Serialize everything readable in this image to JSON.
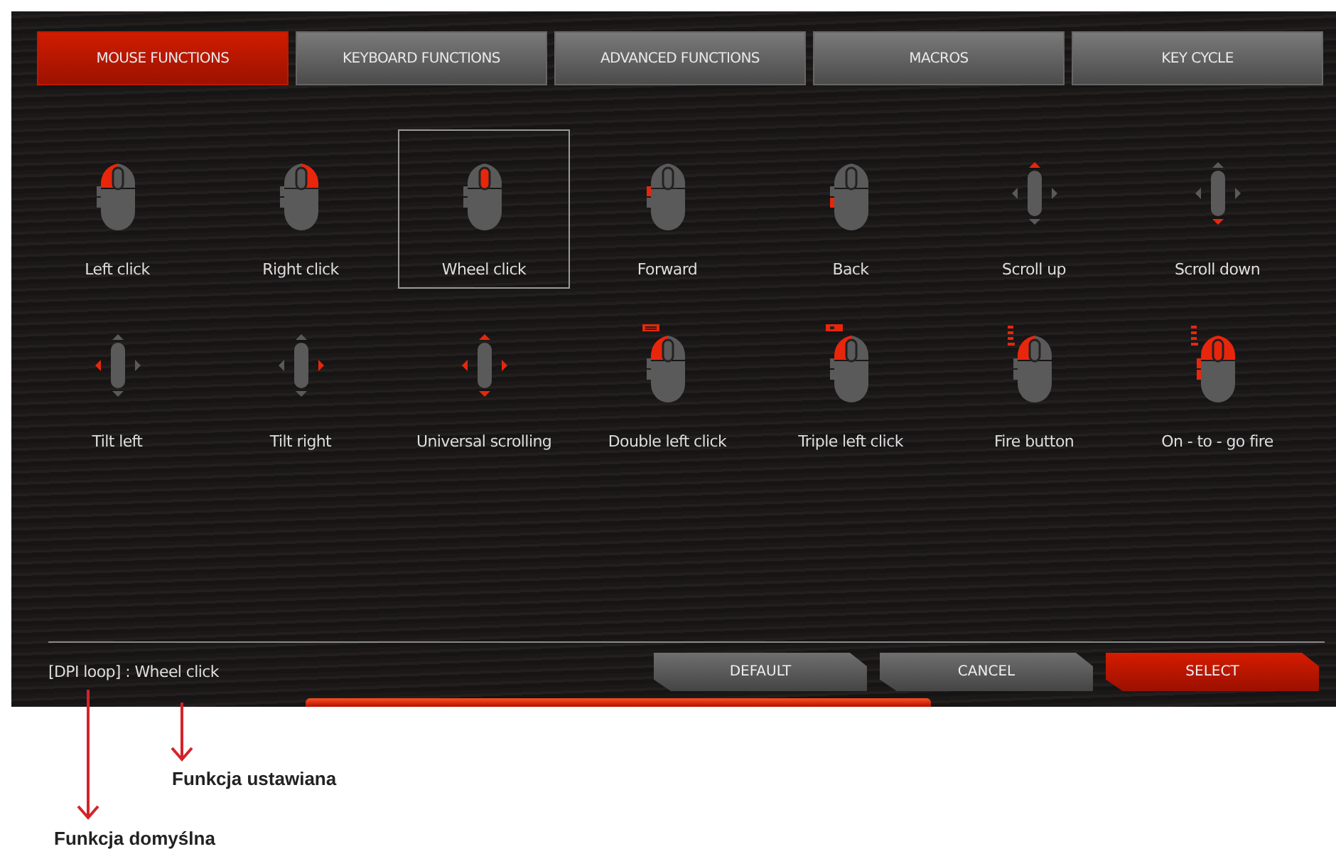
{
  "tabs": [
    {
      "label": "MOUSE FUNCTIONS",
      "selected": true
    },
    {
      "label": "KEYBOARD FUNCTIONS",
      "selected": false
    },
    {
      "label": "ADVANCED FUNCTIONS",
      "selected": false
    },
    {
      "label": "MACROS",
      "selected": false
    },
    {
      "label": "KEY CYCLE",
      "selected": false
    }
  ],
  "functions": [
    {
      "label": "Left click",
      "kind": "left",
      "selected": false
    },
    {
      "label": "Right click",
      "kind": "right",
      "selected": false
    },
    {
      "label": "Wheel click",
      "kind": "wheel",
      "selected": true
    },
    {
      "label": "Forward",
      "kind": "forward",
      "selected": false
    },
    {
      "label": "Back",
      "kind": "back",
      "selected": false
    },
    {
      "label": "Scroll up",
      "kind": "scroll-up",
      "selected": false
    },
    {
      "label": "Scroll down",
      "kind": "scroll-down",
      "selected": false
    },
    {
      "label": "Tilt left",
      "kind": "tilt-left",
      "selected": false
    },
    {
      "label": "Tilt right",
      "kind": "tilt-right",
      "selected": false
    },
    {
      "label": "Universal scrolling",
      "kind": "scroll-all",
      "selected": false
    },
    {
      "label": "Double left click",
      "kind": "double",
      "selected": false
    },
    {
      "label": "Triple left click",
      "kind": "triple",
      "selected": false
    },
    {
      "label": "Fire button",
      "kind": "fire",
      "selected": false
    },
    {
      "label": "On - to - go fire",
      "kind": "onetogo",
      "selected": false
    }
  ],
  "status": "[DPI loop] : Wheel click",
  "buttons": [
    {
      "label": "DEFAULT",
      "kind": "secondary"
    },
    {
      "label": "CANCEL",
      "kind": "secondary"
    },
    {
      "label": "SELECT",
      "kind": "primary"
    }
  ],
  "annotations": [
    {
      "label": "Funkcja ustawiana",
      "kind": "near"
    },
    {
      "label": "Funkcja domyślna",
      "kind": "far"
    }
  ]
}
